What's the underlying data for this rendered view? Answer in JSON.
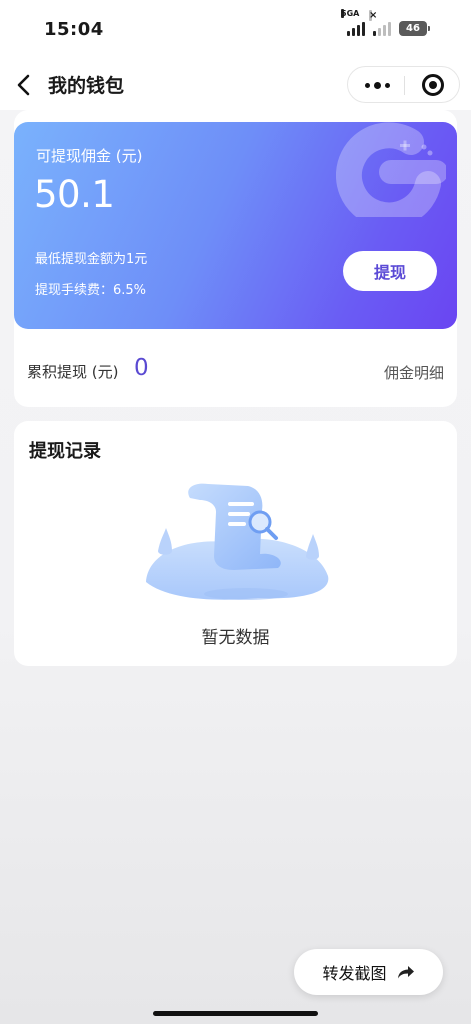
{
  "status_bar": {
    "time": "15:04",
    "network": "5GA",
    "battery": "46"
  },
  "nav": {
    "title": "我的钱包"
  },
  "wallet": {
    "balance_label": "可提现佣金 (元)",
    "balance_value": "50.1",
    "min_note": "最低提现金额为1元",
    "fee_note": "提现手续费：6.5%",
    "withdraw_label": "提现",
    "total_label": "累积提现 (元)",
    "total_value": "0",
    "detail_link": "佣金明细"
  },
  "records": {
    "title": "提现记录",
    "empty_text": "暂无数据"
  },
  "share": {
    "label": "转发截图"
  },
  "colors": {
    "accent": "#6a45f2",
    "gradient_start": "#7ab2fc",
    "value_text": "#5a4ad2"
  },
  "icons": [
    "back-icon",
    "more-icon",
    "close-mini-icon",
    "brand-logo",
    "empty-records-illustration",
    "share-arrow-icon"
  ]
}
